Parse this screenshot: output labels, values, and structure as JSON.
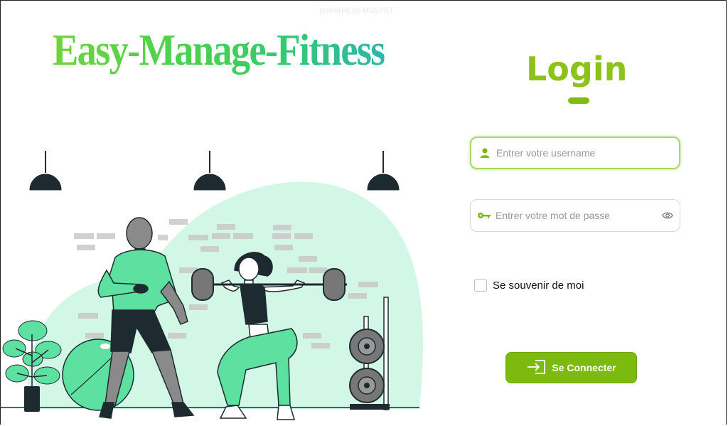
{
  "powered_by": "powered by MaSYST",
  "brand": {
    "title": "Easy-Manage-Fitness"
  },
  "login": {
    "title": "Login",
    "username": {
      "placeholder": "Entrer votre username",
      "value": ""
    },
    "password": {
      "placeholder": "Entrer votre mot de passe",
      "value": ""
    },
    "remember_label": "Se souvenir de moi",
    "remember_checked": false,
    "submit_label": "Se Connecter"
  },
  "colors": {
    "accent": "#8cc21a",
    "button": "#7cba10",
    "illustration_green": "#5ee0a0",
    "illustration_bg": "#d3f7e6",
    "dark": "#1d2b30"
  },
  "icons": {
    "username": "user-icon",
    "password": "key-icon",
    "password_toggle": "eye-icon",
    "submit": "login-icon"
  }
}
